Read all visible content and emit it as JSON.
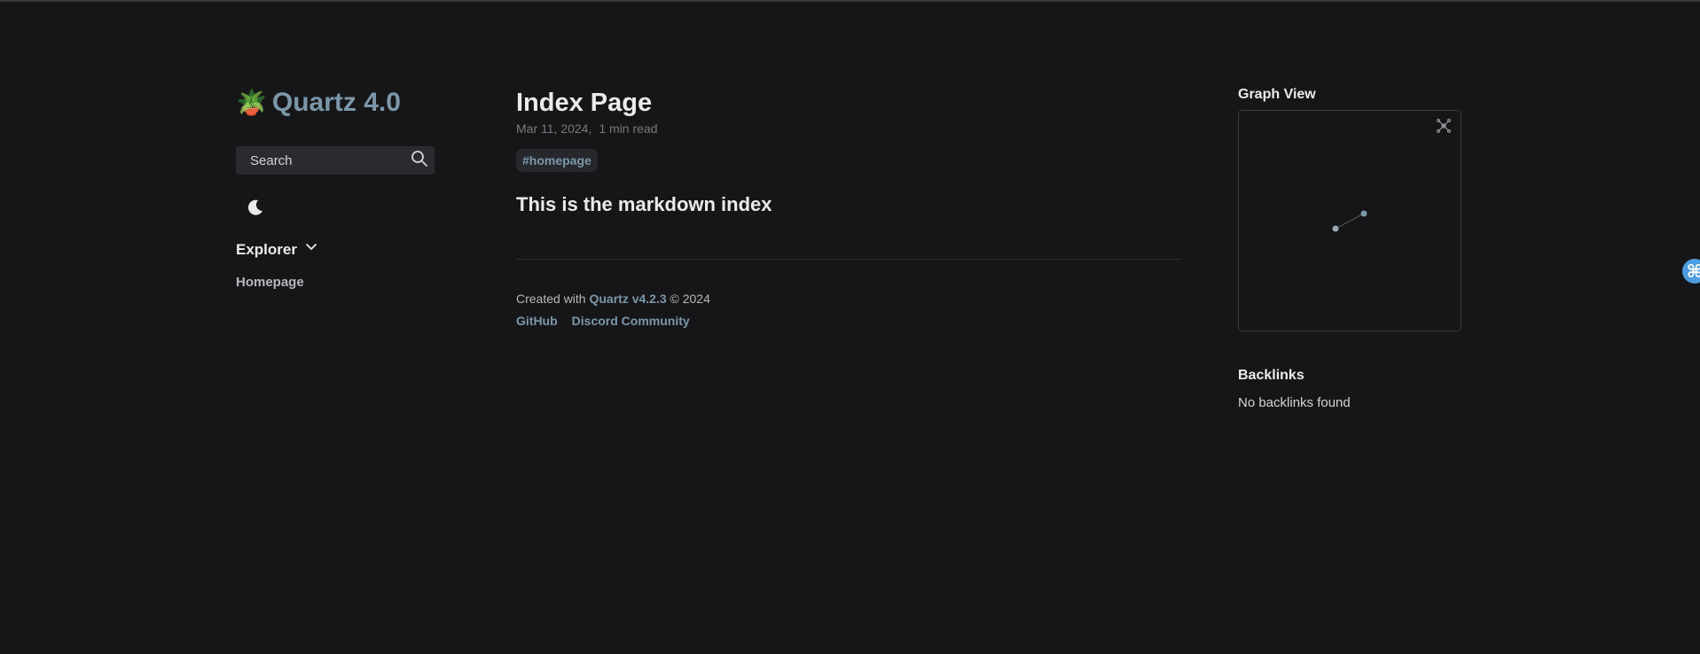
{
  "site": {
    "title": "Quartz 4.0",
    "logo_emoji": "🪴"
  },
  "search": {
    "placeholder": "Search"
  },
  "explorer": {
    "title": "Explorer",
    "items": [
      {
        "label": "Homepage"
      }
    ]
  },
  "page": {
    "title": "Index Page",
    "date": "Mar 11, 2024,",
    "read_time": "1 min read",
    "tags": [
      "#homepage"
    ],
    "heading": "This is the markdown index"
  },
  "footer": {
    "created_prefix": "Created with",
    "quartz_link": "Quartz v4.2.3",
    "copyright": "© 2024",
    "links": [
      "GitHub",
      "Discord Community"
    ]
  },
  "graph": {
    "title": "Graph View"
  },
  "backlinks": {
    "title": "Backlinks",
    "empty": "No backlinks found"
  },
  "floating": {
    "glyph": "⌘"
  },
  "colors": {
    "background": "#161618",
    "accent": "#7b97aa",
    "text": "#ebebec",
    "cmd": "#4d9de0"
  }
}
